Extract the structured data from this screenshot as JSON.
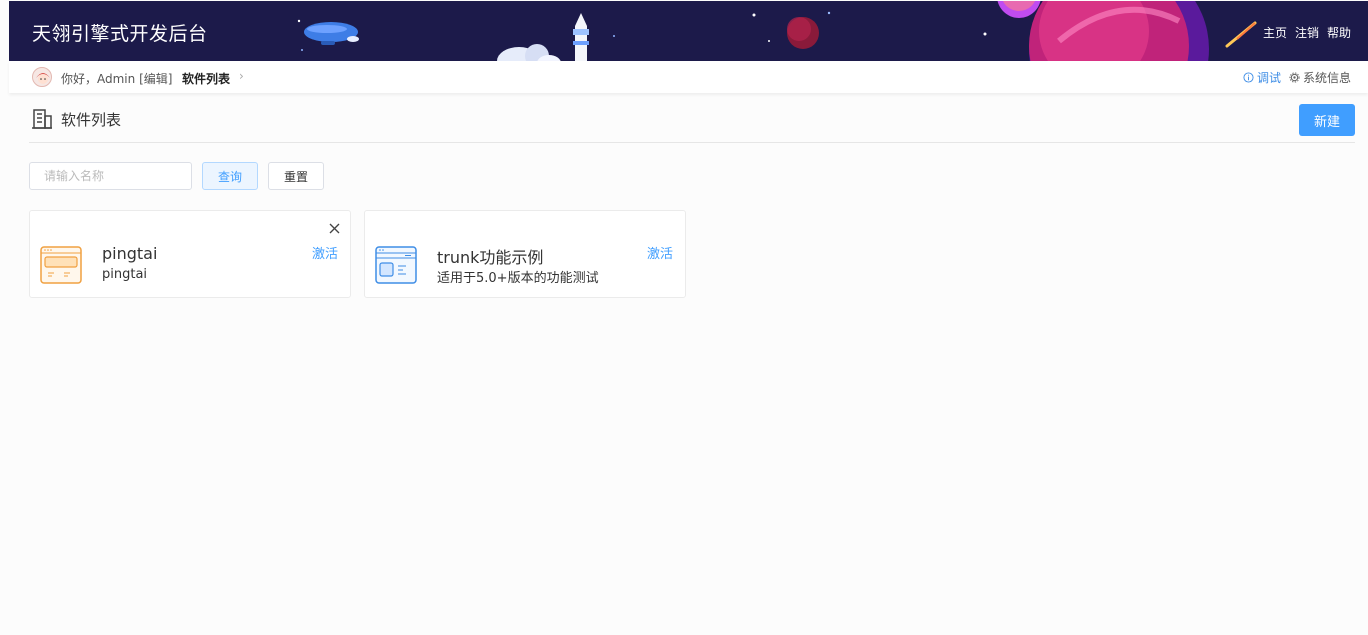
{
  "header": {
    "app_title": "天翎引擎式开发后台",
    "nav": {
      "home": "主页",
      "logout": "注销",
      "help": "帮助"
    }
  },
  "subbar": {
    "greeting_prefix": "你好，Admin",
    "edit_label": "[编辑]",
    "breadcrumb": "软件列表",
    "debug_label": "调试",
    "sysinfo_label": "系统信息"
  },
  "page": {
    "title": "软件列表",
    "new_button": "新建"
  },
  "search": {
    "placeholder": "请输入名称",
    "value": "",
    "query_button": "查询",
    "reset_button": "重置"
  },
  "cards": [
    {
      "name": "pingtai",
      "description": "pingtai",
      "action": "激活",
      "icon": "app-window-icon-orange",
      "closable": true,
      "accent": "#f0a040"
    },
    {
      "name": "trunk功能示例",
      "description": "适用于5.0+版本的功能测试",
      "action": "激活",
      "icon": "app-window-icon-blue",
      "closable": false,
      "accent": "#3e8de6"
    }
  ],
  "colors": {
    "header_bg": "#1c1a4a",
    "primary": "#409eff",
    "link": "#3e8de6"
  }
}
